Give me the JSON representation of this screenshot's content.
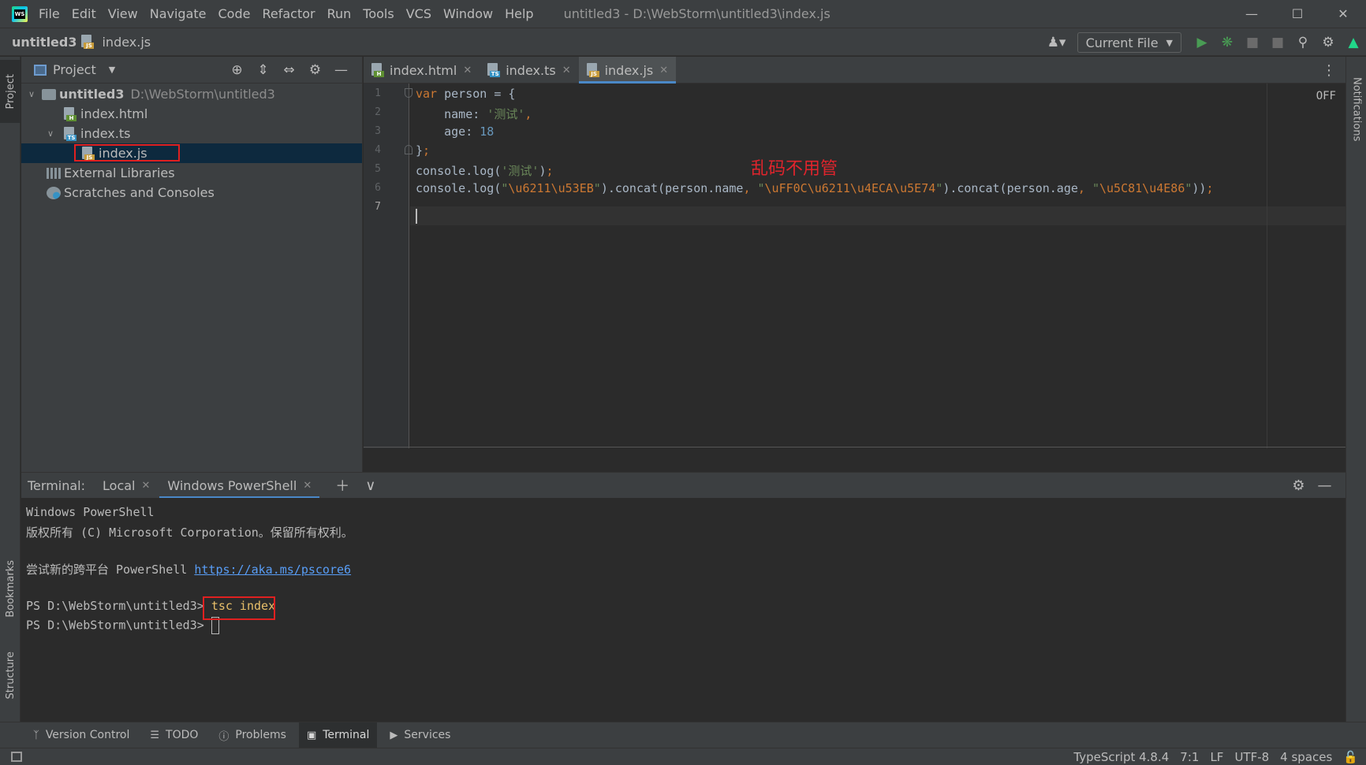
{
  "window": {
    "title": "untitled3 - D:\\WebStorm\\untitled3\\index.js",
    "menu": [
      "File",
      "Edit",
      "View",
      "Navigate",
      "Code",
      "Refactor",
      "Run",
      "Tools",
      "VCS",
      "Window",
      "Help"
    ]
  },
  "navbar": {
    "project": "untitled3",
    "file": "index.js",
    "run_config": "Current File"
  },
  "left_strip": {
    "project": "Project",
    "bookmarks": "Bookmarks",
    "structure": "Structure"
  },
  "right_strip": {
    "notifications": "Notifications"
  },
  "project_panel": {
    "title": "Project",
    "tree": [
      {
        "label": "untitled3",
        "path": "D:\\WebStorm\\untitled3",
        "kind": "folder",
        "expanded": true
      },
      {
        "label": "index.html",
        "kind": "html"
      },
      {
        "label": "index.ts",
        "kind": "ts",
        "expanded": true
      },
      {
        "label": "index.js",
        "kind": "js",
        "selected": true
      },
      {
        "label": "External Libraries",
        "kind": "library"
      },
      {
        "label": "Scratches and Consoles",
        "kind": "scratch"
      }
    ]
  },
  "editor": {
    "tabs": [
      {
        "label": "index.html",
        "kind": "html"
      },
      {
        "label": "index.ts",
        "kind": "ts"
      },
      {
        "label": "index.js",
        "kind": "js",
        "active": true
      }
    ],
    "line_numbers": [
      "1",
      "2",
      "3",
      "4",
      "5",
      "6",
      "7"
    ],
    "readonly_badge": "OFF",
    "annotation": "乱码不用管"
  },
  "terminal": {
    "label": "Terminal:",
    "tabs": [
      {
        "label": "Local"
      },
      {
        "label": "Windows PowerShell",
        "active": true
      }
    ],
    "lines": {
      "l1": "Windows PowerShell",
      "l2": "版权所有 (C) Microsoft Corporation。保留所有权利。",
      "l3_prefix": "尝试新的跨平台 PowerShell ",
      "l3_link": "https://aka.ms/pscore6",
      "prompt": "PS D:\\WebStorm\\untitled3>",
      "command": "tsc index"
    }
  },
  "toolwindows": [
    {
      "label": "Version Control",
      "icon": "branch-icon"
    },
    {
      "label": "TODO",
      "icon": "list-icon"
    },
    {
      "label": "Problems",
      "icon": "problems-icon"
    },
    {
      "label": "Terminal",
      "icon": "terminal-icon",
      "active": true
    },
    {
      "label": "Services",
      "icon": "services-icon"
    }
  ],
  "statusbar": {
    "language": "TypeScript 4.8.4",
    "position": "7:1",
    "line_sep": "LF",
    "encoding": "UTF-8",
    "indent": "4 spaces"
  },
  "colors": {
    "accent": "#4a88c7",
    "annotation_red": "#e0242c",
    "highlight_box": "#e02020"
  }
}
